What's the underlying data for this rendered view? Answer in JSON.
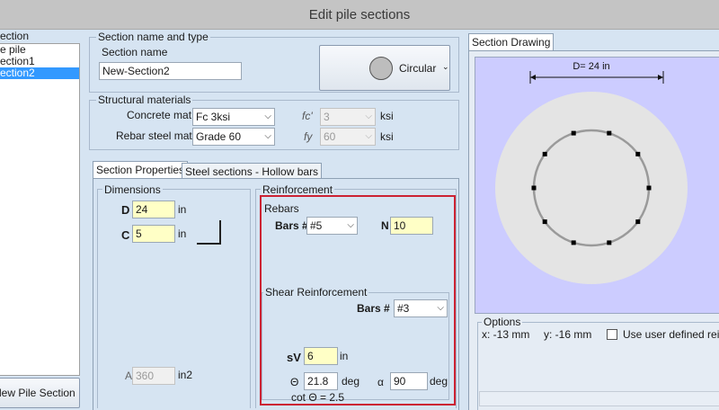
{
  "window": {
    "title": "Edit pile sections"
  },
  "sections_list": {
    "header": "ection",
    "items": [
      "e pile",
      "ection1",
      "ection2"
    ],
    "selected_index": 2,
    "new_button_label": "lew Pile Section"
  },
  "name_type": {
    "group_label": "Section name and type",
    "name_label": "Section name",
    "name_value": "New-Section2",
    "shape_label": "Circular"
  },
  "materials": {
    "group_label": "Structural materials",
    "concrete_label": "Concrete mat.",
    "concrete_value": "Fc 3ksi",
    "fc_label": "fc'",
    "fc_value": "3",
    "fc_unit": "ksi",
    "rebar_label": "Rebar steel mat.",
    "rebar_value": "Grade 60",
    "fy_label": "fy",
    "fy_value": "60",
    "fy_unit": "ksi"
  },
  "tabs": [
    "Section Properties",
    "Steel sections - Hollow bars"
  ],
  "dimensions": {
    "group_label": "Dimensions",
    "d_label": "D",
    "d_value": "24",
    "d_unit": "in",
    "c_label": "C",
    "c_value": "5",
    "c_unit": "in",
    "a_label": "A",
    "a_value": "360",
    "a_unit": "in2"
  },
  "reinforcement": {
    "group_label": "Reinforcement",
    "rebars_label": "Rebars",
    "bars_label": "Bars #",
    "bars_value": "#5",
    "n_label": "N",
    "n_value": "10",
    "shear_label": "Shear Reinforcement",
    "shear_bars_label": "Bars #",
    "shear_bars_value": "#3",
    "sv_label": "sV",
    "sv_value": "6",
    "sv_unit": "in",
    "theta_label": "Θ",
    "theta_value": "21.8",
    "theta_unit": "deg",
    "alpha_label": "α",
    "alpha_value": "90",
    "alpha_unit": "deg",
    "cot_text": "cot Θ  = 2.5"
  },
  "drawing": {
    "tab_label": "Section Drawing",
    "dim_label": "D= 24 in",
    "bar_count": 10
  },
  "options": {
    "group_label": "Options",
    "x_coord": "x: -13 mm",
    "y_coord": "y: -16 mm",
    "user_defined_label": "Use user defined reinf"
  },
  "colors": {
    "window_bg": "#d6e4f2",
    "drawing_bg": "#ccccff",
    "highlight": "#cc2233",
    "selection": "#3399ff",
    "input_yellow": "#ffffc6"
  }
}
